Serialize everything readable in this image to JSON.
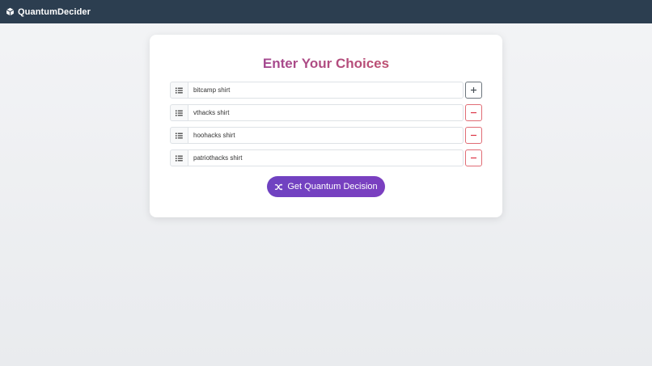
{
  "app": {
    "brand": "QuantumDecider"
  },
  "form": {
    "title": "Enter Your Choices",
    "choices": [
      {
        "value": "bitcamp shirt",
        "action": "add"
      },
      {
        "value": "vthacks shirt",
        "action": "remove"
      },
      {
        "value": "hoohacks shirt",
        "action": "remove"
      },
      {
        "value": "patriothacks shirt",
        "action": "remove"
      }
    ],
    "submit_label": "Get Quantum Decision"
  },
  "colors": {
    "navbar": "#2c3e50",
    "accent": "#6f42c1",
    "remove": "#dc3545",
    "title_gradient_start": "#8e44ad",
    "title_gradient_end": "#d35454"
  },
  "icons": {
    "brand": "cube-icon",
    "list": "list-icon",
    "add": "plus-icon",
    "remove": "minus-icon",
    "submit": "shuffle-icon"
  }
}
